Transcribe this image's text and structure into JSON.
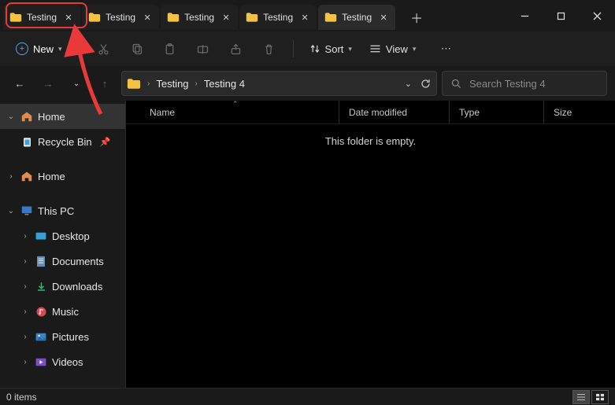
{
  "tabs": [
    {
      "label": "Testing",
      "active": false
    },
    {
      "label": "Testing",
      "active": false
    },
    {
      "label": "Testing",
      "active": false
    },
    {
      "label": "Testing",
      "active": false
    },
    {
      "label": "Testing",
      "active": true
    }
  ],
  "toolbar": {
    "new_label": "New",
    "sort_label": "Sort",
    "view_label": "View"
  },
  "breadcrumb": {
    "items": [
      "Testing",
      "Testing 4"
    ]
  },
  "search": {
    "placeholder": "Search Testing 4"
  },
  "sidebar": {
    "home": "Home",
    "recycle": "Recycle Bin",
    "home2": "Home",
    "thispc": "This PC",
    "desktop": "Desktop",
    "documents": "Documents",
    "downloads": "Downloads",
    "music": "Music",
    "pictures": "Pictures",
    "videos": "Videos"
  },
  "columns": {
    "name": "Name",
    "date": "Date modified",
    "type": "Type",
    "size": "Size"
  },
  "empty_message": "This folder is empty.",
  "status": {
    "items": "0 items"
  }
}
